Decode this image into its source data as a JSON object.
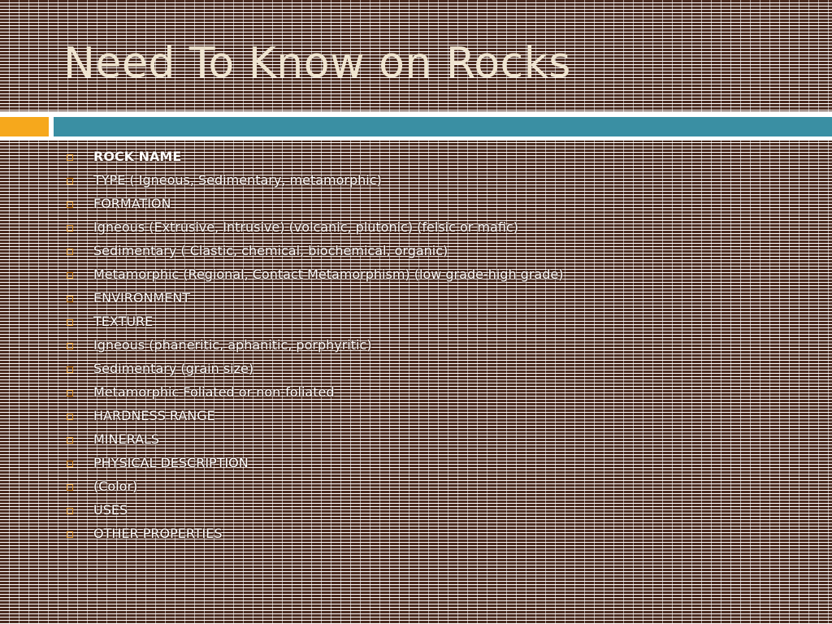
{
  "slide": {
    "title": "Need To Know on Rocks",
    "colors": {
      "title": "#efe4d0",
      "accent_orange": "#f6a81c",
      "accent_teal": "#3a8fa3",
      "bullet": "#e0952c",
      "background": "#4a2a1e"
    }
  },
  "bullets": [
    {
      "text": "ROCK NAME"
    },
    {
      "text": "TYPE ( Igneous, Sedimentary, metamorphic)"
    },
    {
      "text": "FORMATION"
    },
    {
      "text": "Igneous (Extrusive, Intrusive) (volcanic, plutonic) (felsic or mafic)"
    },
    {
      "text": "Sedimentary ( Clastic, chemical, biochemical, organic)"
    },
    {
      "text": "Metamorphic (Regional, Contact Metamorphism) (low grade-high grade)"
    },
    {
      "text": "ENVIRONMENT"
    },
    {
      "text": "TEXTURE"
    },
    {
      "text": "Igneous (phaneritic, aphanitic, porphyritic)"
    },
    {
      "text": "Sedimentary (grain size)"
    },
    {
      "text": "Metamorphic Foliated or non-foliated"
    },
    {
      "text": "HARDNESS RANGE"
    },
    {
      "text": "MINERALS"
    },
    {
      "text": "PHYSICAL DESCRIPTION"
    },
    {
      "text": "(Color)"
    },
    {
      "text": "USES"
    },
    {
      "text": "OTHER PROPERTIES"
    }
  ]
}
